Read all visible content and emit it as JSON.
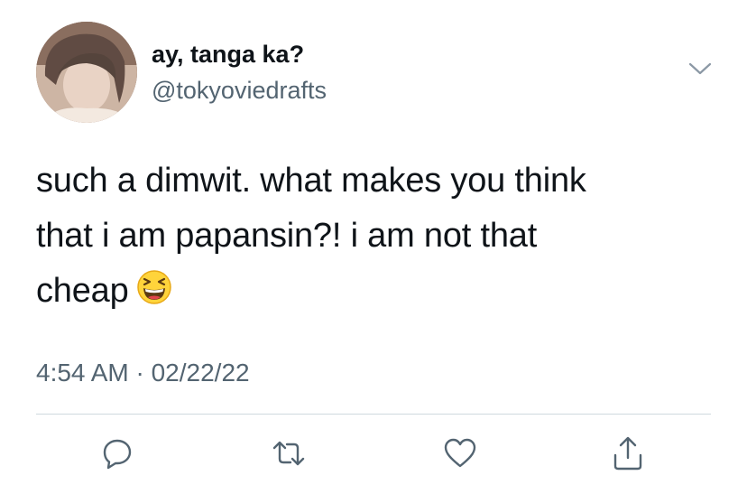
{
  "author": {
    "name": "ay, tanga ka?",
    "handle": "@tokyoviedrafts",
    "avatar_icon": "profile-photo"
  },
  "tweet": {
    "text_line1": "such a dimwit. what makes you think",
    "text_line2": "that i am papansin?! i am not that",
    "text_line3": "cheap",
    "emoji_icon": "grinning-squinting-face-icon",
    "timestamp": "4:54 AM · 02/22/22"
  },
  "actions": {
    "reply_icon": "reply-icon",
    "retweet_icon": "retweet-icon",
    "like_icon": "heart-icon",
    "share_icon": "share-icon"
  },
  "colors": {
    "text": "#0f1419",
    "secondary": "#536471",
    "divider": "#cfd9de",
    "background": "#ffffff"
  }
}
